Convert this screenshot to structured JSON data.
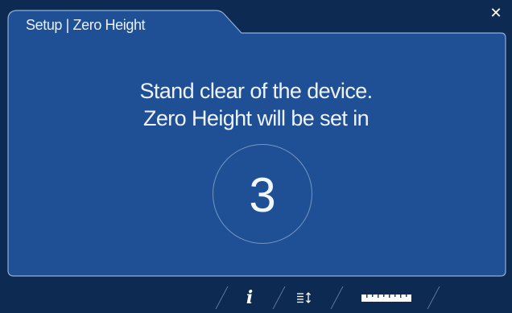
{
  "header": {
    "title": "Setup | Zero Height",
    "close_icon": "close-icon"
  },
  "message": {
    "line1": "Stand clear of the device.",
    "line2": "Zero Height will be set in"
  },
  "countdown": {
    "value": "3"
  },
  "bottom_nav": {
    "items": [
      {
        "icon": "info-icon",
        "glyph": "i"
      },
      {
        "icon": "list-sort-icon"
      },
      {
        "icon": "ruler-icon"
      }
    ]
  },
  "colors": {
    "background": "#0d2a52",
    "panel": "#1f4f94",
    "panel_border": "#8fb0d8",
    "text": "#eef3fa"
  }
}
